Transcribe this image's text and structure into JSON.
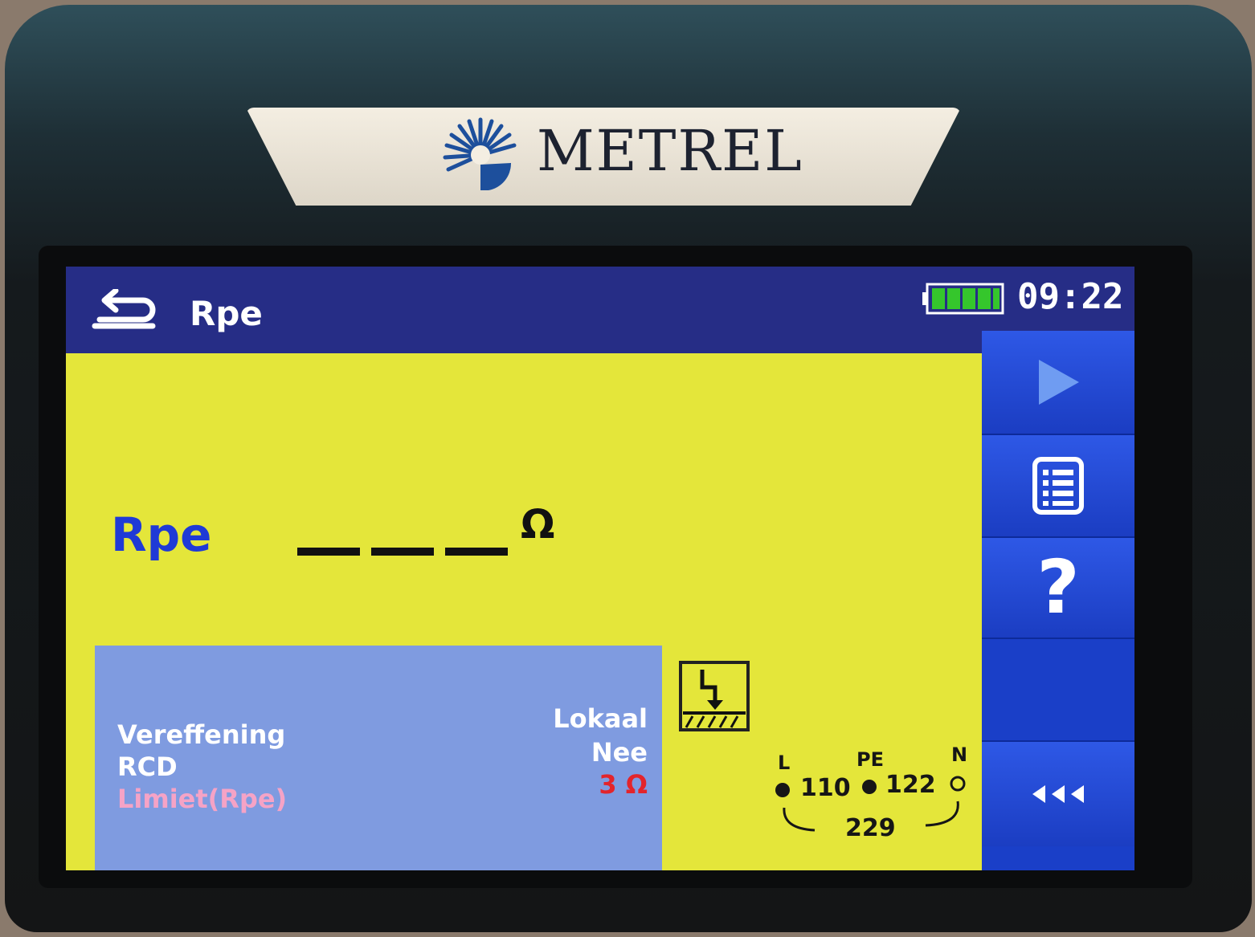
{
  "brand": {
    "name": "METREL",
    "accent_color": "#1d4f9c"
  },
  "titlebar": {
    "back_icon": "back-arrow-icon",
    "title": "Rpe",
    "battery_icon": "battery-full-icon",
    "time": "09:22"
  },
  "result": {
    "label": "Rpe",
    "value": "",
    "unit": "Ω"
  },
  "params": [
    {
      "name": "Vereffening",
      "value": "Lokaal"
    },
    {
      "name": "RCD",
      "value": "Nee"
    },
    {
      "name": "Limiet(Rpe)",
      "value": "3 Ω"
    }
  ],
  "sidebar": {
    "start_icon": "play-icon",
    "memory_icon": "list-icon",
    "help_icon": "help-icon",
    "help_label": "?",
    "options_icon": "triple-arrow-left-icon"
  },
  "earth_icon": "earth-symbol-icon",
  "voltages": {
    "l_label": "L",
    "pe_label": "PE",
    "n_label": "N",
    "l_pe": "110",
    "pe_n": "122",
    "l_n": "229"
  },
  "colors": {
    "screen_background": "#e4e63a",
    "titlebar": "#262d86",
    "sidebar": "#1a3fc8",
    "result_label": "#1f3ad6",
    "params_panel": "#7f9be0",
    "limit_value": "#e3242b",
    "battery": "#35c62c"
  }
}
